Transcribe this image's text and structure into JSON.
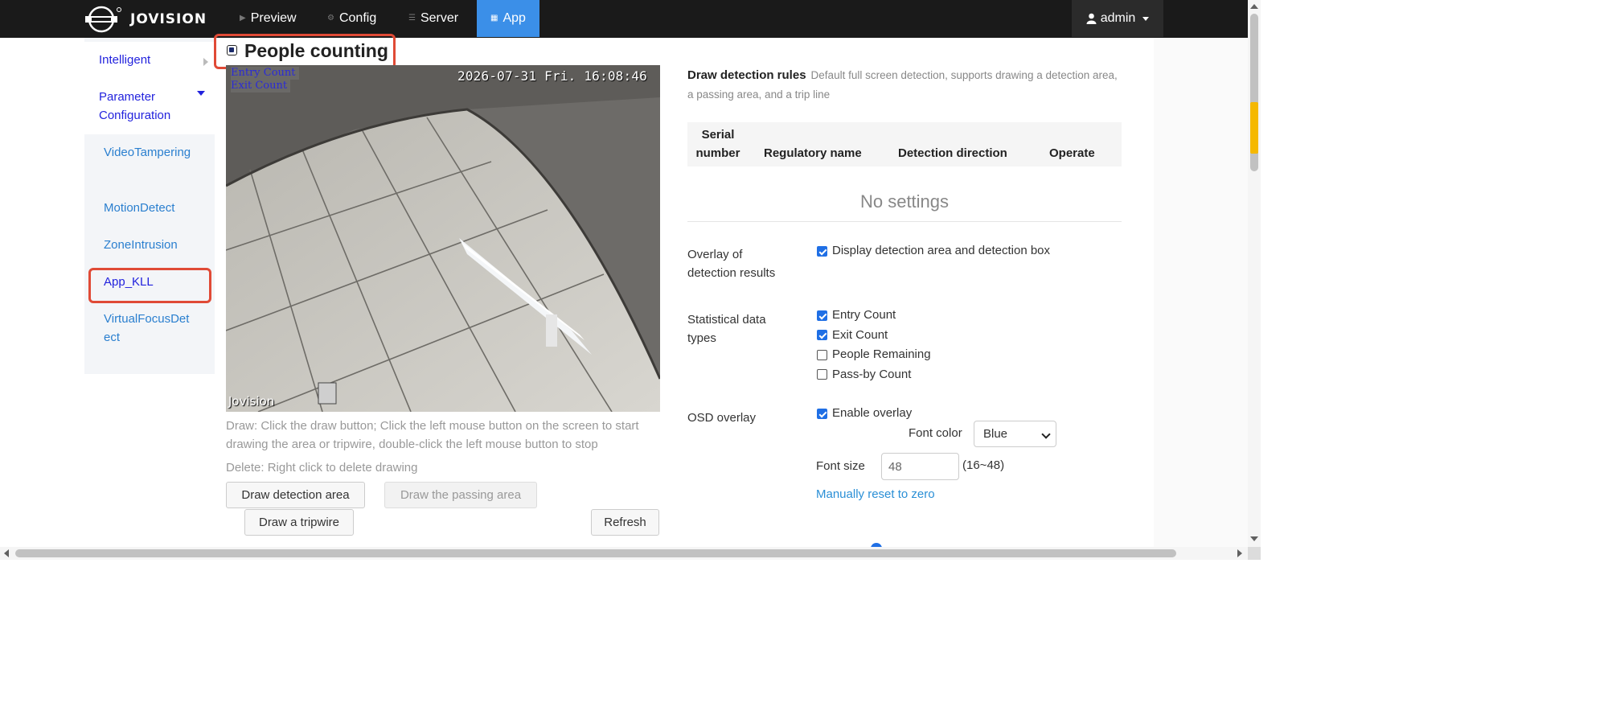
{
  "brand": {
    "name": "JOVISION"
  },
  "nav": {
    "items": [
      {
        "label": "Preview",
        "icon": "play-icon"
      },
      {
        "label": "Config",
        "icon": "gear-icon"
      },
      {
        "label": "Server",
        "icon": "list-icon"
      },
      {
        "label": "App",
        "icon": "grid-icon",
        "active": true
      }
    ],
    "user": "admin"
  },
  "sidebar": {
    "sections": [
      {
        "label": "Intelligent",
        "expanded": false
      },
      {
        "label": "Parameter Configuration",
        "expanded": true
      }
    ],
    "items": [
      {
        "label": "VideoTampering"
      },
      {
        "label": "MotionDetect"
      },
      {
        "label": "ZoneIntrusion"
      },
      {
        "label": "App_KLL",
        "selected": true
      },
      {
        "label": "VirtualFocusDetect"
      }
    ]
  },
  "page": {
    "title": "People counting",
    "enabled": true
  },
  "video": {
    "osd_lines": [
      "Entry Count",
      "Exit Count"
    ],
    "timestamp": "2026-07-31 Fri. 16:08:46",
    "watermark": "Jovision"
  },
  "help": {
    "draw": "Draw: Click the draw button; Click the left mouse button on the screen to start drawing the area or tripwire, double-click the left mouse button to stop",
    "delete": "Delete: Right click to delete drawing"
  },
  "buttons": {
    "draw_area": "Draw detection area",
    "draw_passing": "Draw the passing area",
    "draw_tripwire": "Draw a tripwire",
    "refresh": "Refresh"
  },
  "rules": {
    "title": "Draw detection rules",
    "subtitle": "Default full screen detection, supports drawing a detection area, a passing area, and a trip line",
    "columns": [
      "Serial number",
      "Regulatory name",
      "Detection direction",
      "Operate"
    ],
    "empty_text": "No settings"
  },
  "form": {
    "overlay_results": {
      "label": "Overlay of detection results",
      "option": "Display detection area and detection box",
      "checked": true
    },
    "stat_types": {
      "label": "Statistical data types",
      "options": [
        {
          "label": "Entry Count",
          "checked": true
        },
        {
          "label": "Exit Count",
          "checked": true
        },
        {
          "label": "People Remaining",
          "checked": false
        },
        {
          "label": "Pass-by Count",
          "checked": false
        }
      ]
    },
    "osd": {
      "label": "OSD overlay",
      "option": "Enable overlay",
      "checked": true,
      "font_color_label": "Font color",
      "font_color_value": "Blue",
      "font_size_label": "Font size",
      "font_size_value": "48",
      "font_size_range": "(16~48)",
      "reset_link": "Manually reset to zero"
    }
  },
  "colors": {
    "accent": "#3b8fe8",
    "nav_bg": "#1a1a1a",
    "highlight": "#e04a36",
    "link": "#2a8fd6",
    "checkbox": "#1f6fe5"
  }
}
